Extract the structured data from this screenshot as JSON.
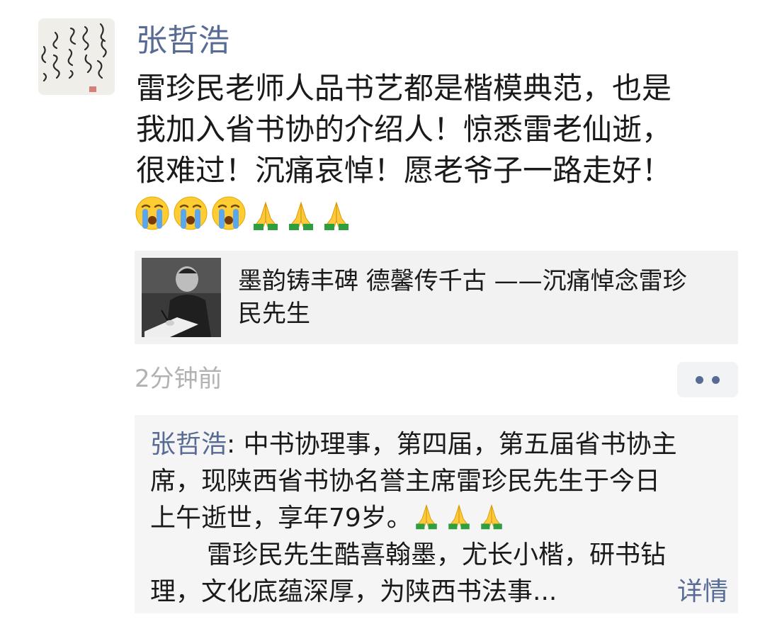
{
  "post": {
    "author": "张哲浩",
    "text_lines": [
      "雷珍民老师人品书艺都是楷模典范，也是",
      "我加入省书协的介绍人！惊悉雷老仙逝，",
      "很难过！沉痛哀悼！愿老爷子一路走好！"
    ],
    "emojis": [
      "crying-face-icon",
      "crying-face-icon",
      "crying-face-icon",
      "folded-hands-icon",
      "folded-hands-icon",
      "folded-hands-icon"
    ]
  },
  "share_card": {
    "title_lines": [
      "墨韵铸丰碑 德馨传千古 ——沉痛悼念雷珍",
      "民先生"
    ]
  },
  "meta": {
    "timestamp": "2分钟前"
  },
  "comments": [
    {
      "name": "张哲浩",
      "separator": ": ",
      "line1": "中书协理事，第四届，第五届省书协主",
      "line2": "席，现陕西省书协名誉主席雷珍民先生于今日",
      "line3": "上午逝世，享年79岁。",
      "line4": "雷珍民先生酷喜翰墨，尤长小楷，研书钻",
      "line5": "理，文化底蕴深厚，为陕西书法事...",
      "detail_label": "详情"
    }
  ],
  "colors": {
    "link": "#576b95",
    "timestamp": "#b2b2b2",
    "card_bg": "#f2f2f2",
    "comment_bg": "#f5f5f5"
  }
}
